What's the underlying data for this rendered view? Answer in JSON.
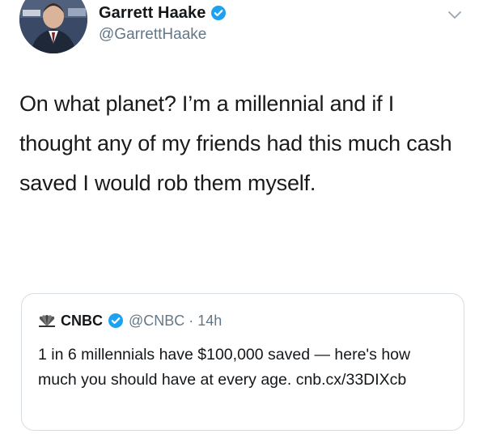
{
  "tweet": {
    "display_name": "Garrett Haake",
    "handle": "@GarrettHaake",
    "verified_icon": "verified-badge-icon",
    "menu_icon": "chevron-down-icon",
    "text": "On what planet? I’m a millennial and if I thought any of my friends had this much cash saved I would rob them myself."
  },
  "quoted_tweet": {
    "logo_icon": "nbc-peacock-icon",
    "display_name": "CNBC",
    "handle_time": "@CNBC · 14h",
    "text": "1 in 6 millennials have $100,000 saved — here's how much you should have at every age. cnb.cx/33DIXcb"
  },
  "colors": {
    "verified_blue": "#1da1f2",
    "secondary_text": "#657786",
    "border": "#d6dde3"
  }
}
